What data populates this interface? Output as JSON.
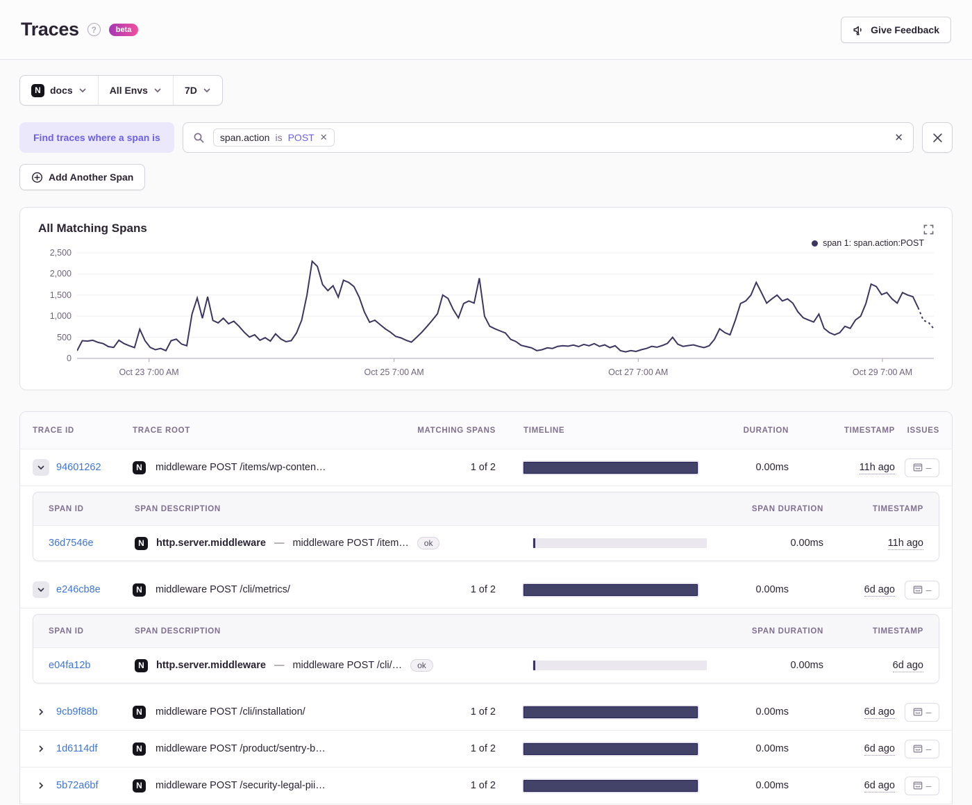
{
  "header": {
    "title": "Traces",
    "beta_label": "beta",
    "feedback_label": "Give Feedback"
  },
  "filters": {
    "project_icon_letter": "N",
    "project": "docs",
    "environment": "All Envs",
    "period": "7D"
  },
  "search": {
    "where_label": "Find traces where a span is",
    "token": {
      "key": "span.action",
      "op": "is",
      "value": "POST"
    },
    "add_span_label": "Add Another Span"
  },
  "chart": {
    "title": "All Matching Spans",
    "legend_label": "span 1: span.action:POST",
    "line_color": "#3b3560"
  },
  "chart_data": {
    "type": "line",
    "title": "All Matching Spans",
    "series_name": "span 1: span.action:POST",
    "ylim": [
      0,
      2500
    ],
    "yticks": [
      "2,500",
      "2,000",
      "1,500",
      "1,000",
      "500",
      "0"
    ],
    "xticks": [
      {
        "label": "Oct 23 7:00 AM",
        "pos": 0.084
      },
      {
        "label": "Oct 25 7:00 AM",
        "pos": 0.37
      },
      {
        "label": "Oct 27 7:00 AM",
        "pos": 0.655
      },
      {
        "label": "Oct 29 7:00 AM",
        "pos": 0.94
      }
    ],
    "values": [
      180,
      420,
      410,
      430,
      380,
      350,
      280,
      260,
      430,
      350,
      300,
      255,
      690,
      420,
      260,
      205,
      235,
      185,
      420,
      455,
      340,
      300,
      1050,
      1430,
      950,
      1460,
      900,
      840,
      950,
      820,
      880,
      760,
      620,
      505,
      560,
      430,
      490,
      410,
      580,
      460,
      395,
      420,
      600,
      905,
      1500,
      2300,
      2180,
      1750,
      1605,
      1720,
      1450,
      1850,
      1800,
      1700,
      1450,
      1100,
      855,
      905,
      800,
      700,
      620,
      520,
      485,
      430,
      385,
      500,
      620,
      760,
      905,
      1060,
      1500,
      1420,
      1160,
      960,
      1300,
      1360,
      1310,
      1900,
      1000,
      760,
      700,
      650,
      600,
      450,
      400,
      310,
      280,
      250,
      185,
      205,
      250,
      235,
      285,
      300,
      290,
      315,
      280,
      330,
      300,
      350,
      285,
      320,
      255,
      300,
      185,
      155,
      185,
      165,
      205,
      235,
      285,
      265,
      305,
      355,
      500,
      335,
      285,
      305,
      320,
      285,
      255,
      300,
      450,
      700,
      610,
      560,
      905,
      1300,
      1360,
      1500,
      1800,
      1560,
      1310,
      1410,
      1500,
      1360,
      1410,
      1310,
      1100,
      960,
      910,
      860,
      1050,
      710,
      610,
      560,
      610,
      760,
      710,
      910,
      1000,
      1300,
      1760,
      1700,
      1510,
      1560,
      1410,
      1310,
      1560,
      1500,
      1460,
      1200,
      900,
      850,
      700
    ]
  },
  "table": {
    "headers": {
      "trace_id": "TRACE ID",
      "trace_root": "TRACE ROOT",
      "matching_spans": "MATCHING SPANS",
      "timeline": "TIMELINE",
      "duration": "DURATION",
      "timestamp": "TIMESTAMP",
      "issues": "ISSUES"
    },
    "sub_headers": {
      "span_id": "SPAN ID",
      "span_description": "SPAN DESCRIPTION",
      "span_duration": "SPAN DURATION",
      "timestamp": "TIMESTAMP"
    },
    "issues_dash": "–",
    "rows": [
      {
        "trace_id": "94601262",
        "root": "middleware POST /items/wp-conten…",
        "matching": "1 of 2",
        "duration": "0.00ms",
        "timestamp": "11h ago",
        "spans": [
          {
            "span_id": "36d7546e",
            "op": "http.server.middleware",
            "sep": "—",
            "desc": "middleware POST /item…",
            "status": "ok",
            "duration": "0.00ms",
            "timestamp": "11h ago"
          }
        ]
      },
      {
        "trace_id": "e246cb8e",
        "root": "middleware POST /cli/metrics/",
        "matching": "1 of 2",
        "duration": "0.00ms",
        "timestamp": "6d ago",
        "spans": [
          {
            "span_id": "e04fa12b",
            "op": "http.server.middleware",
            "sep": "—",
            "desc": "middleware POST /cli/…",
            "status": "ok",
            "duration": "0.00ms",
            "timestamp": "6d ago"
          }
        ]
      },
      {
        "trace_id": "9cb9f88b",
        "root": "middleware POST /cli/installation/",
        "matching": "1 of 2",
        "duration": "0.00ms",
        "timestamp": "6d ago"
      },
      {
        "trace_id": "1d6114df",
        "root": "middleware POST /product/sentry-b…",
        "matching": "1 of 2",
        "duration": "0.00ms",
        "timestamp": "6d ago"
      },
      {
        "trace_id": "5b72a6bf",
        "root": "middleware POST /security-legal-pii…",
        "matching": "1 of 2",
        "duration": "0.00ms",
        "timestamp": "6d ago"
      }
    ]
  }
}
